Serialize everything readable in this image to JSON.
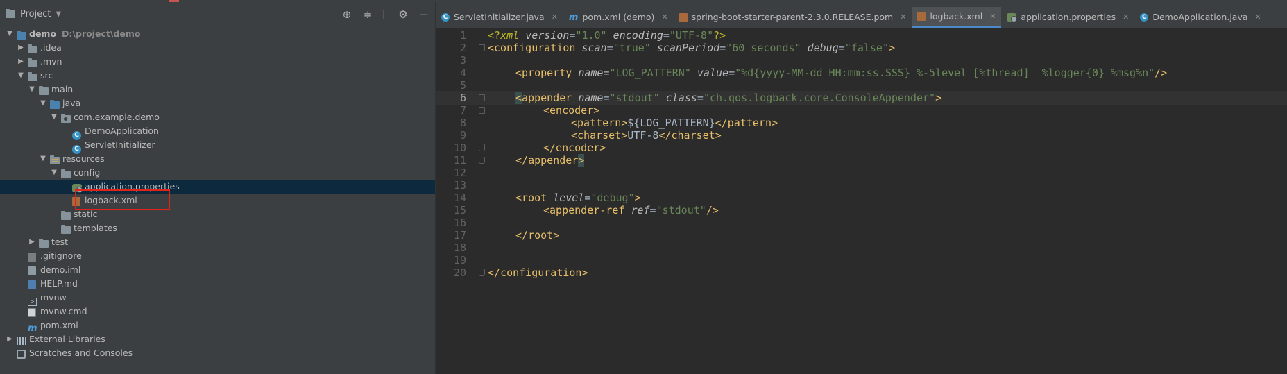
{
  "project_panel": {
    "title": "Project",
    "tools": [
      "locate-icon",
      "collapse-icon",
      "gear-icon",
      "minimize-icon"
    ],
    "tree": [
      {
        "label": "demo",
        "path": "D:\\project\\demo",
        "level": 0,
        "arrow": "▼",
        "icon": "module-folder"
      },
      {
        "label": ".idea",
        "level": 1,
        "arrow": "▶",
        "icon": "folder"
      },
      {
        "label": ".mvn",
        "level": 1,
        "arrow": "▶",
        "icon": "folder"
      },
      {
        "label": "src",
        "level": 1,
        "arrow": "▼",
        "icon": "folder"
      },
      {
        "label": "main",
        "level": 2,
        "arrow": "▼",
        "icon": "folder"
      },
      {
        "label": "java",
        "level": 3,
        "arrow": "▼",
        "icon": "source-folder"
      },
      {
        "label": "com.example.demo",
        "level": 4,
        "arrow": "▼",
        "icon": "package"
      },
      {
        "label": "DemoApplication",
        "level": 5,
        "arrow": "",
        "icon": "spring-class"
      },
      {
        "label": "ServletInitializer",
        "level": 5,
        "arrow": "",
        "icon": "class"
      },
      {
        "label": "resources",
        "level": 3,
        "arrow": "▼",
        "icon": "resources-folder"
      },
      {
        "label": "config",
        "level": 4,
        "arrow": "▼",
        "icon": "folder"
      },
      {
        "label": "application.properties",
        "level": 5,
        "arrow": "",
        "icon": "properties",
        "selected": true
      },
      {
        "label": "logback.xml",
        "level": 5,
        "arrow": "",
        "icon": "xml",
        "highlighted": true
      },
      {
        "label": "static",
        "level": 4,
        "arrow": "",
        "icon": "folder"
      },
      {
        "label": "templates",
        "level": 4,
        "arrow": "",
        "icon": "folder"
      },
      {
        "label": "test",
        "level": 2,
        "arrow": "▶",
        "icon": "folder"
      },
      {
        "label": ".gitignore",
        "level": 1,
        "arrow": "",
        "icon": "gitignore"
      },
      {
        "label": "demo.iml",
        "level": 1,
        "arrow": "",
        "icon": "iml"
      },
      {
        "label": "HELP.md",
        "level": 1,
        "arrow": "",
        "icon": "markdown"
      },
      {
        "label": "mvnw",
        "level": 1,
        "arrow": "",
        "icon": "shell"
      },
      {
        "label": "mvnw.cmd",
        "level": 1,
        "arrow": "",
        "icon": "cmd"
      },
      {
        "label": "pom.xml",
        "level": 1,
        "arrow": "",
        "icon": "maven"
      },
      {
        "label": "External Libraries",
        "level": 0,
        "arrow": "▶",
        "icon": "libraries"
      },
      {
        "label": "Scratches and Consoles",
        "level": 0,
        "arrow": "",
        "icon": "scratches"
      }
    ]
  },
  "editor": {
    "tabs": [
      {
        "label": "ServletInitializer.java",
        "icon": "class-icon",
        "active": false
      },
      {
        "label": "pom.xml (demo)",
        "icon": "maven-icon",
        "active": false
      },
      {
        "label": "spring-boot-starter-parent-2.3.0.RELEASE.pom",
        "icon": "xml-icon",
        "active": false
      },
      {
        "label": "logback.xml",
        "icon": "xml-icon",
        "active": true
      },
      {
        "label": "application.properties",
        "icon": "properties-icon",
        "active": false
      },
      {
        "label": "DemoApplication.java",
        "icon": "class-icon",
        "active": false
      }
    ],
    "current_line": 6,
    "line_numbers": [
      "1",
      "2",
      "3",
      "4",
      "5",
      "6",
      "7",
      "8",
      "9",
      "10",
      "11",
      "12",
      "13",
      "14",
      "15",
      "16",
      "17",
      "18",
      "19",
      "20"
    ],
    "code": {
      "l1": {
        "open": "<?",
        "xml": "xml",
        "a1": "version",
        "v1": "\"1.0\"",
        "a2": "encoding",
        "v2": "\"UTF-8\"",
        "close": "?>"
      },
      "l2": {
        "tag": "configuration",
        "a1": "scan",
        "v1": "\"true\"",
        "a2": "scanPeriod",
        "v2": "\"60 seconds\"",
        "a3": "debug",
        "v3": "\"false\""
      },
      "l4": {
        "tag": "property",
        "a1": "name",
        "v1": "\"LOG_PATTERN\"",
        "a2": "value",
        "v2": "\"%d{yyyy-MM-dd HH:mm:ss.SSS} %-5level [%thread]  %logger{0} %msg%n\""
      },
      "l6": {
        "tag": "appender",
        "a1": "name",
        "v1": "\"stdout\"",
        "a2": "class",
        "v2": "\"ch.qos.logback.core.ConsoleAppender\""
      },
      "l7": {
        "tag": "encoder"
      },
      "l8": {
        "tag": "pattern",
        "text": "${LOG_PATTERN}"
      },
      "l9": {
        "tag": "charset",
        "text": "UTF-8"
      },
      "l10": {
        "tag": "encoder"
      },
      "l11": {
        "tag": "appender"
      },
      "l14": {
        "tag": "root",
        "a1": "level",
        "v1": "\"debug\""
      },
      "l15": {
        "tag": "appender-ref",
        "a1": "ref",
        "v1": "\"stdout\""
      },
      "l17": {
        "tag": "root"
      },
      "l20": {
        "tag": "configuration"
      }
    }
  }
}
